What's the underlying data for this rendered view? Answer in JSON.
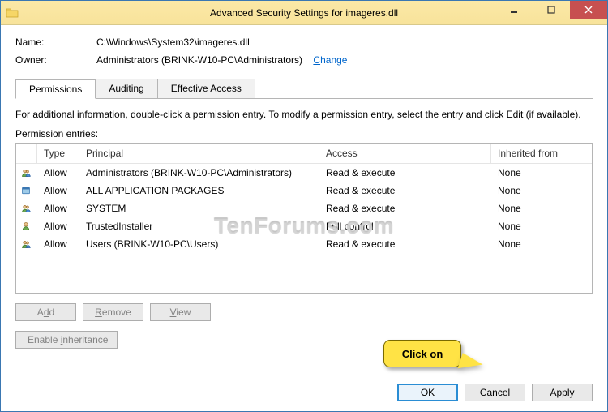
{
  "window": {
    "title": "Advanced Security Settings for imageres.dll"
  },
  "header": {
    "name_label": "Name:",
    "name_value": "C:\\Windows\\System32\\imageres.dll",
    "owner_label": "Owner:",
    "owner_value": "Administrators (BRINK-W10-PC\\Administrators)",
    "change_link": "Change"
  },
  "tabs": {
    "permissions": "Permissions",
    "auditing": "Auditing",
    "effective": "Effective Access"
  },
  "info_text": "For additional information, double-click a permission entry. To modify a permission entry, select the entry and click Edit (if available).",
  "section_label": "Permission entries:",
  "columns": {
    "type": "Type",
    "principal": "Principal",
    "access": "Access",
    "inherited": "Inherited from"
  },
  "rows": [
    {
      "type": "Allow",
      "principal": "Administrators (BRINK-W10-PC\\Administrators)",
      "access": "Read & execute",
      "inherited": "None",
      "icon": "group"
    },
    {
      "type": "Allow",
      "principal": "ALL APPLICATION PACKAGES",
      "access": "Read & execute",
      "inherited": "None",
      "icon": "package"
    },
    {
      "type": "Allow",
      "principal": "SYSTEM",
      "access": "Read & execute",
      "inherited": "None",
      "icon": "group"
    },
    {
      "type": "Allow",
      "principal": "TrustedInstaller",
      "access": "Full control",
      "inherited": "None",
      "icon": "user"
    },
    {
      "type": "Allow",
      "principal": "Users (BRINK-W10-PC\\Users)",
      "access": "Read & execute",
      "inherited": "None",
      "icon": "group"
    }
  ],
  "buttons": {
    "add": "Add",
    "remove": "Remove",
    "view": "View",
    "enable_inheritance": "Enable inheritance",
    "ok": "OK",
    "cancel": "Cancel",
    "apply": "Apply"
  },
  "callout": "Click on",
  "watermark": "TenForums.com"
}
